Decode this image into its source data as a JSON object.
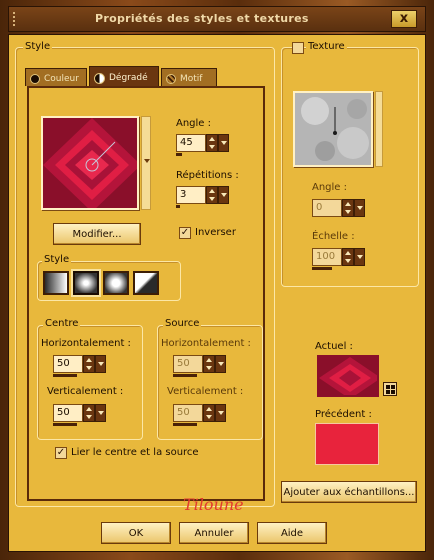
{
  "window": {
    "title": "Propriétés des styles et textures",
    "close_label": "x"
  },
  "style_group": {
    "label": "Style",
    "tabs": [
      {
        "label": "Couleur",
        "active": false
      },
      {
        "label": "Dégradé",
        "active": true
      },
      {
        "label": "Motif",
        "active": false
      }
    ],
    "angle": {
      "label": "Angle :",
      "value": "45"
    },
    "repetitions": {
      "label": "Répétitions :",
      "value": "3"
    },
    "modifier_label": "Modifier...",
    "inverser": {
      "label": "Inverser",
      "checked": true
    },
    "style_subgroup_label": "Style",
    "centre": {
      "label": "Centre",
      "h_label": "Horizontalement :",
      "h_value": "50",
      "v_label": "Verticalement :",
      "v_value": "50"
    },
    "source": {
      "label": "Source",
      "h_label": "Horizontalement :",
      "h_value": "50",
      "v_label": "Verticalement :",
      "v_value": "50"
    },
    "link": {
      "label": "Lier le centre et la source",
      "checked": true
    }
  },
  "texture_group": {
    "label": "Texture",
    "checked": false,
    "angle": {
      "label": "Angle :",
      "value": "0"
    },
    "echelle": {
      "label": "Échelle :",
      "value": "100"
    }
  },
  "actuel_label": "Actuel :",
  "precedent_label": "Précédent :",
  "ajouter_label": "Ajouter aux échantillons...",
  "watermark": "Tiloune",
  "buttons": {
    "ok": "OK",
    "annuler": "Annuler",
    "aide": "Aide"
  },
  "colors": {
    "gradient_dark": "#8a0f2a",
    "gradient_light": "#e01e44",
    "precedent": "#e8233c",
    "panel": "#e8b83c"
  }
}
